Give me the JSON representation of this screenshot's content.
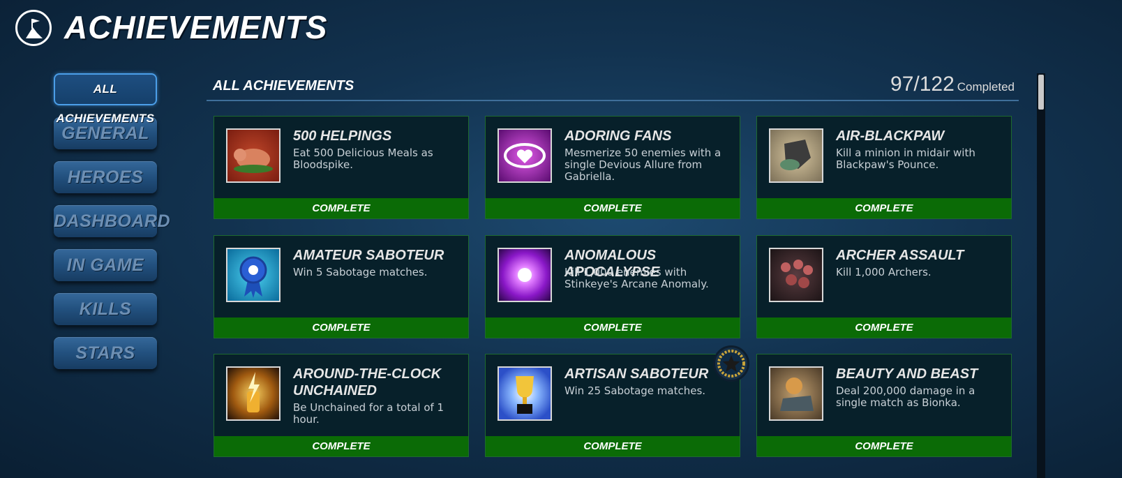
{
  "header": {
    "title": "ACHIEVEMENTS",
    "logo_icon": "flag-emblem-icon"
  },
  "nav": {
    "items": [
      {
        "label": "ALL ACHIEVEMENTS",
        "active": true
      },
      {
        "label": "GENERAL"
      },
      {
        "label": "HEROES"
      },
      {
        "label": "DASHBOARD"
      },
      {
        "label": "IN GAME"
      },
      {
        "label": "KILLS"
      },
      {
        "label": "STARS"
      }
    ]
  },
  "section": {
    "title": "ALL ACHIEVEMENTS",
    "count": "97/122",
    "count_label": "Completed"
  },
  "colors": {
    "complete_bar": "#0b6b06",
    "card_bg": "#07202a",
    "accent": "#4b9ee8"
  },
  "achievements": [
    {
      "title": "500 Helpings",
      "desc": "Eat 500 Delicious Meals as Bloodspike.",
      "status": "COMPLETE",
      "icon": "roast-pig-icon"
    },
    {
      "title": "Adoring Fans",
      "desc": "Mesmerize 50 enemies with a single Devious Allure from Gabriella.",
      "status": "COMPLETE",
      "icon": "heart-eye-icon"
    },
    {
      "title": "Air-Blackpaw",
      "desc": "Kill a minion in midair with Blackpaw's Pounce.",
      "status": "COMPLETE",
      "icon": "blackpaw-pounce-icon"
    },
    {
      "title": "Amateur Saboteur",
      "desc": "Win 5 Sabotage matches.",
      "status": "COMPLETE",
      "icon": "blue-ribbon-icon"
    },
    {
      "title": "Anomalous Apocalypse",
      "desc": "Kill 1,000 enemies with Stinkeye's Arcane Anomaly.",
      "status": "COMPLETE",
      "icon": "arcane-burst-icon"
    },
    {
      "title": "Archer Assault",
      "desc": "Kill 1,000 Archers.",
      "status": "COMPLETE",
      "icon": "archer-horde-icon"
    },
    {
      "title": "Around-the-Clock Unchained",
      "desc": "Be Unchained for a total of 1 hour.",
      "status": "COMPLETE",
      "icon": "lightning-bottle-icon"
    },
    {
      "title": "Artisan Saboteur",
      "desc": "Win 25 Sabotage matches.",
      "status": "COMPLETE",
      "icon": "gold-trophy-icon"
    },
    {
      "title": "Beauty and Beast",
      "desc": "Deal 200,000 damage in a single match as Bionka.",
      "status": "COMPLETE",
      "icon": "bionka-beast-icon"
    }
  ]
}
